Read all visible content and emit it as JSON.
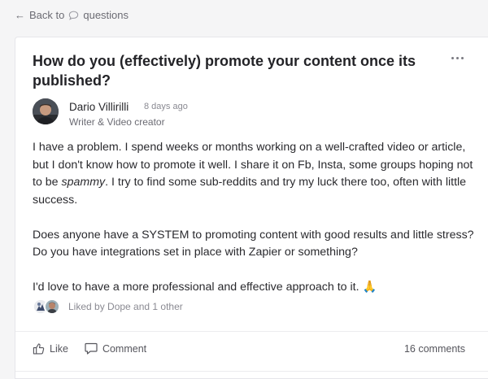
{
  "nav": {
    "back_label": "Back to",
    "back_target": "questions"
  },
  "post": {
    "title": "How do you (effectively) promote your content once its published?",
    "author": {
      "name": "Dario Villirilli",
      "time": "8 days ago",
      "role": "Writer & Video creator"
    },
    "paragraphs": [
      {
        "before": "I have a problem. I spend weeks or months working on a well-crafted video or article, but I don't know how to promote it well. I share it on Fb, Insta, some groups hoping not to be ",
        "emphasis": "spammy",
        "after": ". I try to find some sub-reddits and try my luck there too, often with little success."
      },
      {
        "text": "Does anyone have a SYSTEM to promoting content with good results and little stress? Do you have integrations set in place with Zapier or something?"
      },
      {
        "text": "I'd love to have a more professional and effective approach to it. 🙏"
      }
    ],
    "liked_by": "Liked by Dope and 1 other"
  },
  "actions": {
    "like_label": "Like",
    "comment_label": "Comment",
    "comments_count": "16 comments"
  },
  "icons": {
    "back": "arrow-left-icon",
    "bubble": "speech-bubble-icon",
    "more": "more-horizontal-icon",
    "like": "thumbs-up-icon",
    "comment": "comment-icon"
  }
}
